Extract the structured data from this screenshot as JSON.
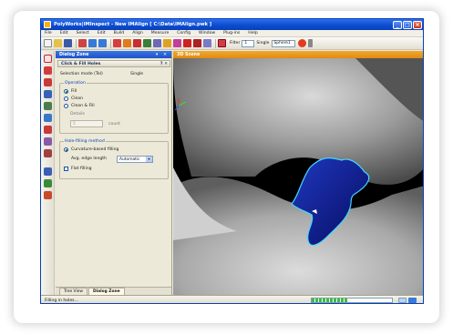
{
  "window": {
    "title": "PolyWorks|IMInspect - New IMAlign [ C:\\Data\\IMAlign.pwk ]",
    "controls": [
      "_",
      "□",
      "×"
    ]
  },
  "menu": [
    "File",
    "Edit",
    "Select",
    "Edit",
    "Build",
    "Align",
    "Measure",
    "Config",
    "Window",
    "Plug-ins",
    "Help"
  ],
  "toolbar": {
    "filter_label": "Filter",
    "filter_value": "1",
    "single_label": "Single",
    "single_value": "Sphere1"
  },
  "panel": {
    "title": "Dialog Zone",
    "subtitle": "Click & Fill Holes",
    "selection_mode_label": "Selection mode (Tel)",
    "selection_mode_value": "Single",
    "operation": {
      "title": "Operation",
      "options": [
        {
          "label": "Fill",
          "selected": true
        },
        {
          "label": "Clean",
          "selected": false
        },
        {
          "label": "Clean & Fill",
          "selected": false
        }
      ],
      "details_label": "Details",
      "details_value": "5",
      "details_unit": "count"
    },
    "method": {
      "title": "Hole-filling method",
      "option_label": "Curvature-based filling",
      "option_selected": true,
      "edge_length_label": "Avg. edge length",
      "edge_length_value": "Automatic",
      "flat_label": "Flat filling",
      "flat_checked": false
    },
    "tabs": [
      {
        "label": "Tree View",
        "active": false
      },
      {
        "label": "Dialog Zone",
        "active": true
      }
    ]
  },
  "viewport": {
    "title": "3D Scene"
  },
  "status": {
    "text": "Filling in holes...",
    "progress": 0.45
  },
  "colors": {
    "hole_fill": "#0b1a8c",
    "hole_outline": "#40d8ff",
    "title_bar": "#0b4ccf",
    "viewport_header": "#e08a10"
  }
}
